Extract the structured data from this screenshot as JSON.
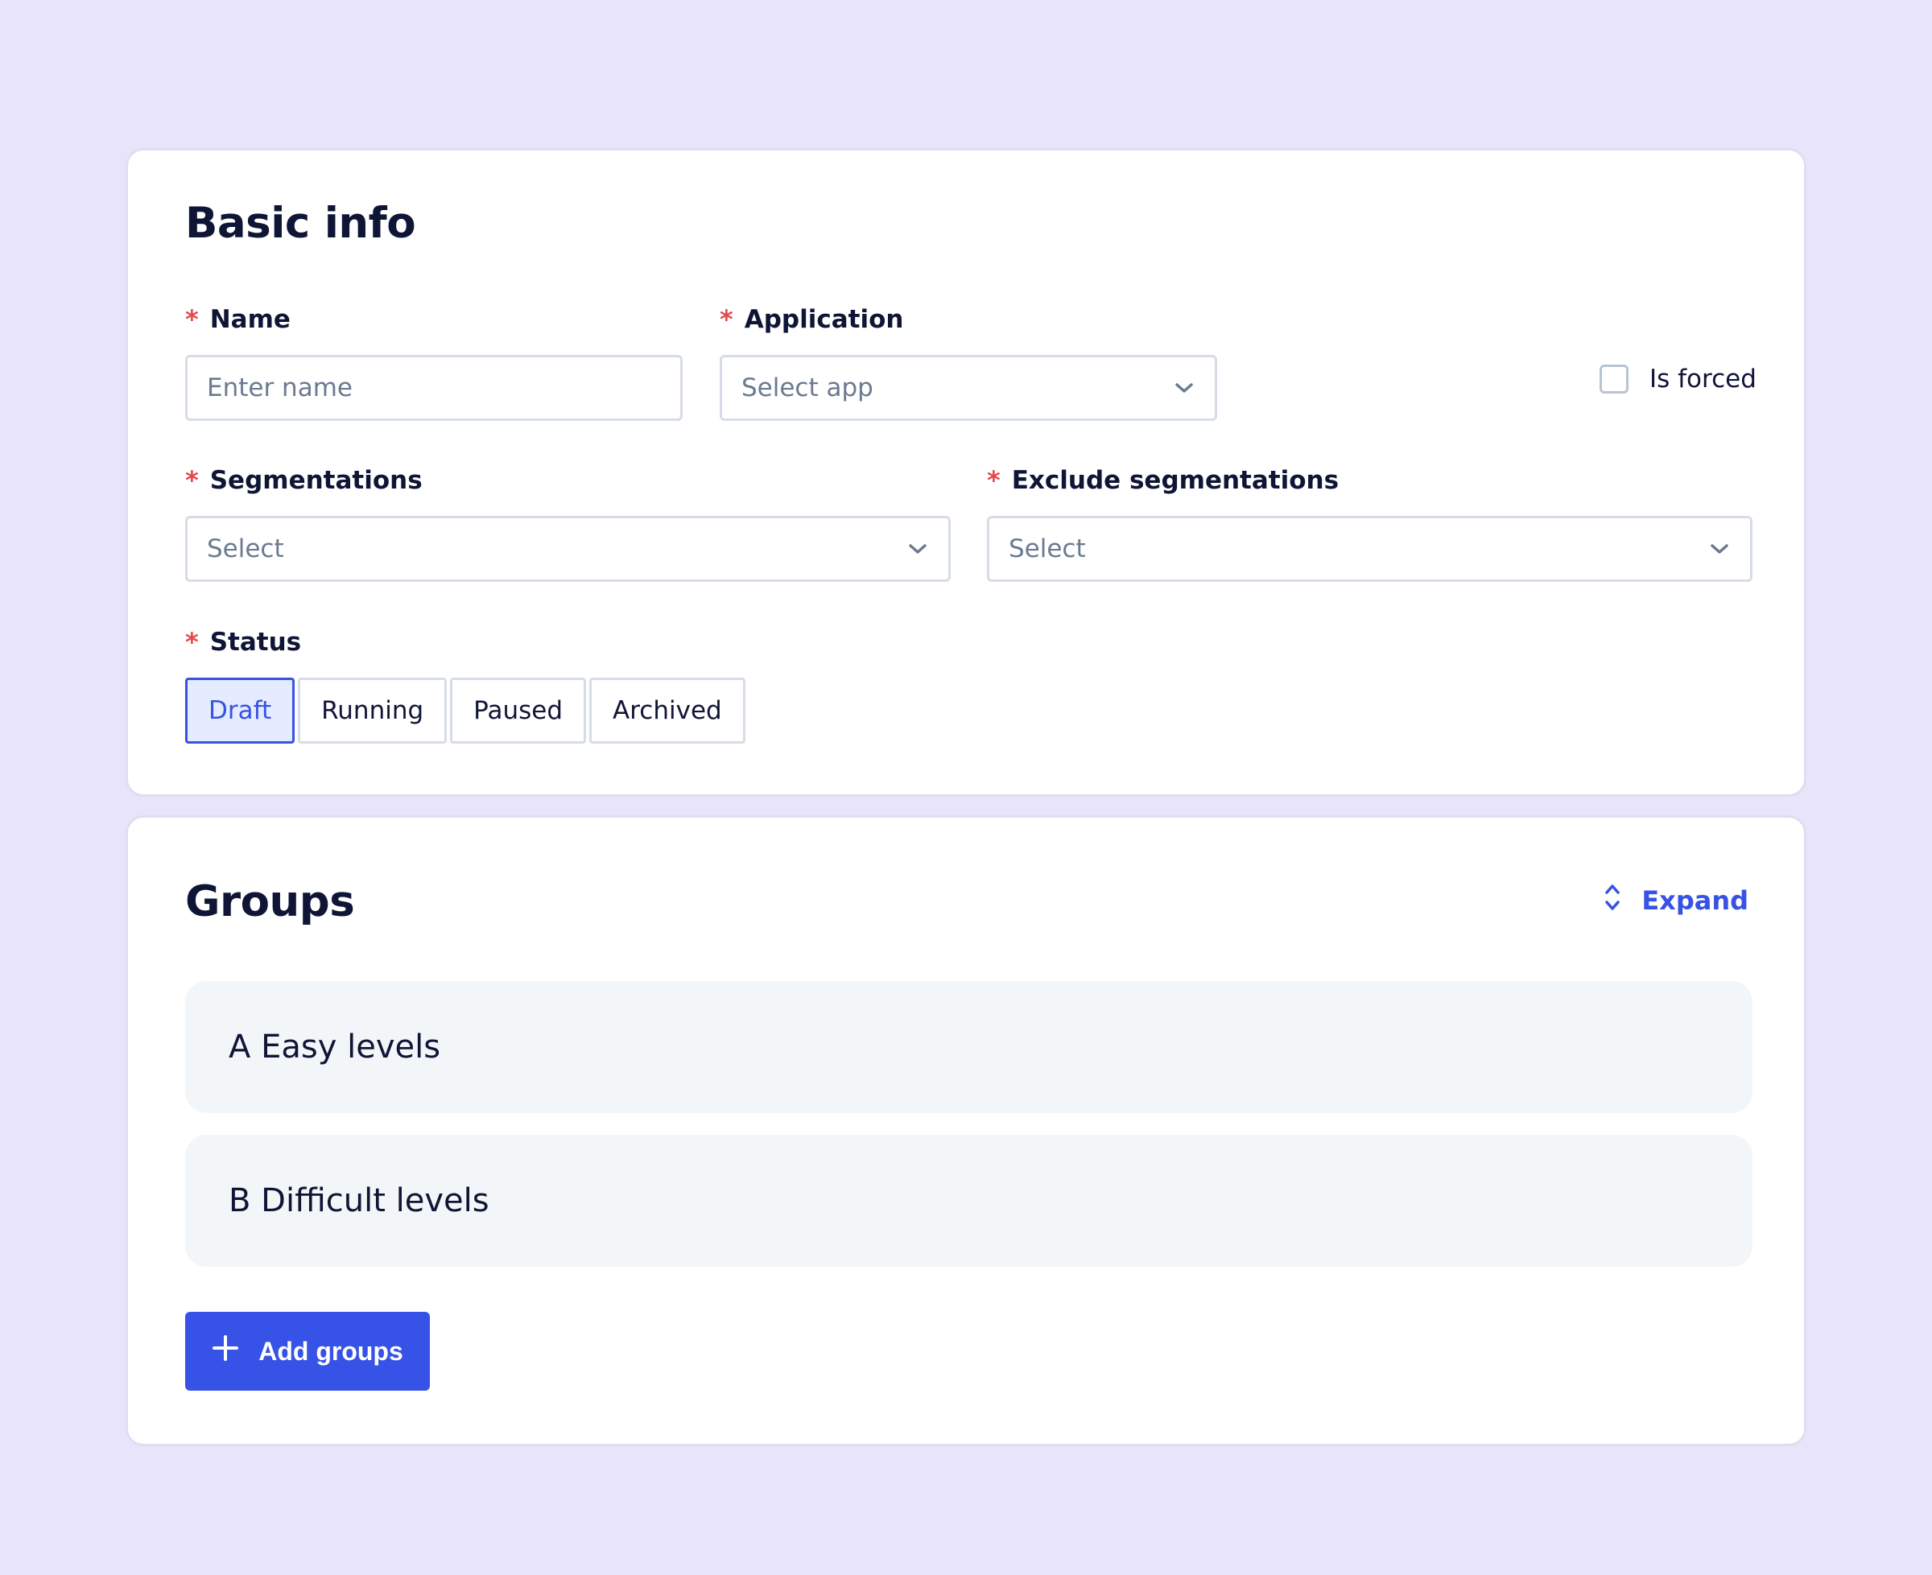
{
  "basic_info": {
    "title": "Basic info",
    "name": {
      "label": "Name",
      "required": "*",
      "placeholder": "Enter name"
    },
    "application": {
      "label": "Application",
      "required": "*",
      "placeholder": "Select app"
    },
    "is_forced": {
      "label": "Is forced",
      "checked": false
    },
    "segmentations": {
      "label": "Segmentations",
      "required": "*",
      "placeholder": "Select"
    },
    "exclude_segmentations": {
      "label": "Exclude segmentations",
      "required": "*",
      "placeholder": "Select"
    },
    "status": {
      "label": "Status",
      "required": "*",
      "options": [
        "Draft",
        "Running",
        "Paused",
        "Archived"
      ],
      "selected": "Draft"
    }
  },
  "groups": {
    "title": "Groups",
    "expand_label": "Expand",
    "items": [
      {
        "label": "A Easy levels"
      },
      {
        "label": "B Difficult levels"
      }
    ],
    "add_label": "Add groups"
  },
  "colors": {
    "accent": "#3752e6",
    "required": "#e5484d",
    "background": "#e8e4fa"
  },
  "icons": {
    "select_chevron": "chevron-down-icon",
    "expand": "expand-collapse-icon",
    "add": "plus-icon"
  }
}
